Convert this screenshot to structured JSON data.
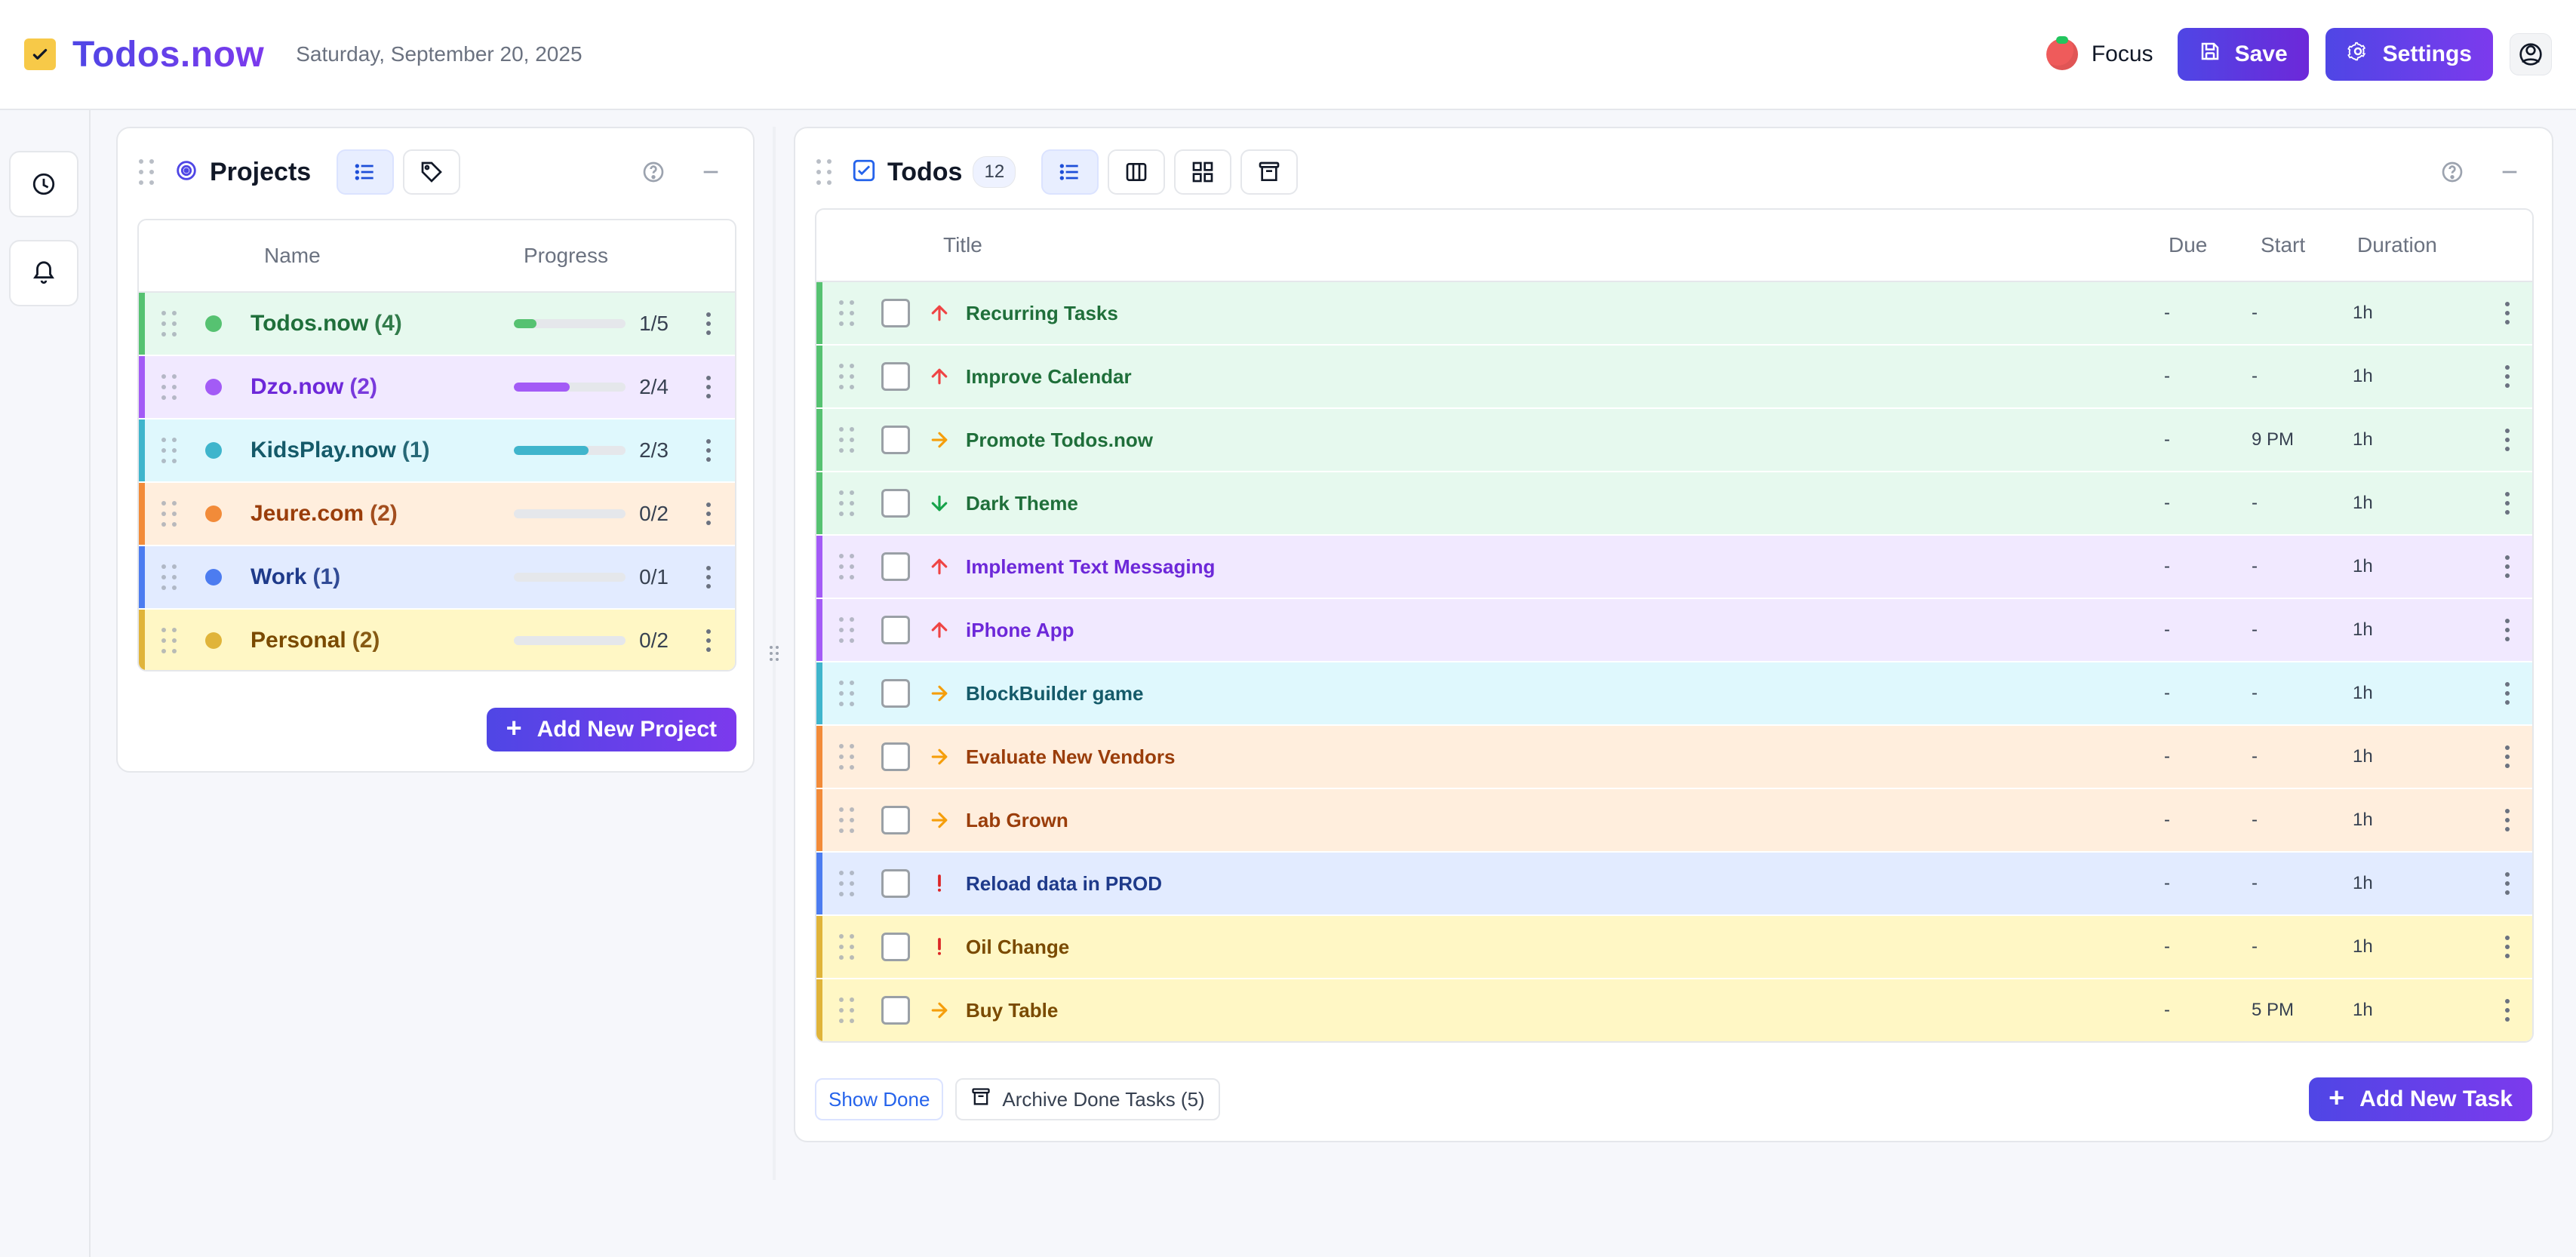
{
  "header": {
    "brand": "Todos.now",
    "date": "Saturday, September 20, 2025",
    "focus_label": "Focus",
    "save_label": "Save",
    "settings_label": "Settings"
  },
  "colors": {
    "green_bg": "#e6f9ee",
    "green_accent": "#56c271",
    "green_text": "#1f6f3a",
    "purple_bg": "#f1e9ff",
    "purple_accent": "#a35bf6",
    "purple_text": "#6d28d9",
    "cyan_bg": "#dff8fd",
    "cyan_accent": "#3fb5cc",
    "cyan_text": "#145a69",
    "orange_bg": "#ffeedd",
    "orange_accent": "#f28b39",
    "orange_text": "#9a3d0a",
    "blue_bg": "#e2ebff",
    "blue_accent": "#4c7cf0",
    "blue_text": "#1e3a8a",
    "yellow_bg": "#fff7c5",
    "yellow_accent": "#e0b43a",
    "yellow_text": "#7a4a00"
  },
  "projects": {
    "title": "Projects",
    "columns": {
      "name": "Name",
      "progress": "Progress"
    },
    "items": [
      {
        "name": "Todos.now",
        "count": "(4)",
        "progress_text": "1/5",
        "fill_fraction": 0.2,
        "color_key": "green"
      },
      {
        "name": "Dzo.now",
        "count": "(2)",
        "progress_text": "2/4",
        "fill_fraction": 0.5,
        "color_key": "purple"
      },
      {
        "name": "KidsPlay.now",
        "count": "(1)",
        "progress_text": "2/3",
        "fill_fraction": 0.67,
        "color_key": "cyan"
      },
      {
        "name": "Jeure.com",
        "count": "(2)",
        "progress_text": "0/2",
        "fill_fraction": 0.0,
        "color_key": "orange"
      },
      {
        "name": "Work",
        "count": "(1)",
        "progress_text": "0/1",
        "fill_fraction": 0.0,
        "color_key": "blue"
      },
      {
        "name": "Personal",
        "count": "(2)",
        "progress_text": "0/2",
        "fill_fraction": 0.0,
        "color_key": "yellow"
      }
    ],
    "add_label": "Add New Project"
  },
  "todos": {
    "title": "Todos",
    "count": "12",
    "columns": {
      "title": "Title",
      "due": "Due",
      "start": "Start",
      "duration": "Duration"
    },
    "items": [
      {
        "title": "Recurring Tasks",
        "due": "-",
        "start": "-",
        "duration": "1h",
        "priority": "up",
        "color_key": "green"
      },
      {
        "title": "Improve Calendar",
        "due": "-",
        "start": "-",
        "duration": "1h",
        "priority": "up",
        "color_key": "green"
      },
      {
        "title": "Promote Todos.now",
        "due": "-",
        "start": "9 PM",
        "duration": "1h",
        "priority": "right",
        "color_key": "green"
      },
      {
        "title": "Dark Theme",
        "due": "-",
        "start": "-",
        "duration": "1h",
        "priority": "down",
        "color_key": "green"
      },
      {
        "title": "Implement Text Messaging",
        "due": "-",
        "start": "-",
        "duration": "1h",
        "priority": "up",
        "color_key": "purple"
      },
      {
        "title": "iPhone App",
        "due": "-",
        "start": "-",
        "duration": "1h",
        "priority": "up",
        "color_key": "purple"
      },
      {
        "title": "BlockBuilder game",
        "due": "-",
        "start": "-",
        "duration": "1h",
        "priority": "right",
        "color_key": "cyan"
      },
      {
        "title": "Evaluate New Vendors",
        "due": "-",
        "start": "-",
        "duration": "1h",
        "priority": "right",
        "color_key": "orange"
      },
      {
        "title": "Lab Grown",
        "due": "-",
        "start": "-",
        "duration": "1h",
        "priority": "right",
        "color_key": "orange"
      },
      {
        "title": "Reload data in PROD",
        "due": "-",
        "start": "-",
        "duration": "1h",
        "priority": "urgent",
        "color_key": "blue"
      },
      {
        "title": "Oil Change",
        "due": "-",
        "start": "-",
        "duration": "1h",
        "priority": "urgent",
        "color_key": "yellow"
      },
      {
        "title": "Buy Table",
        "due": "-",
        "start": "5 PM",
        "duration": "1h",
        "priority": "right",
        "color_key": "yellow"
      }
    ],
    "show_done_label": "Show Done",
    "archive_label": "Archive Done Tasks (5)",
    "add_label": "Add New Task"
  }
}
